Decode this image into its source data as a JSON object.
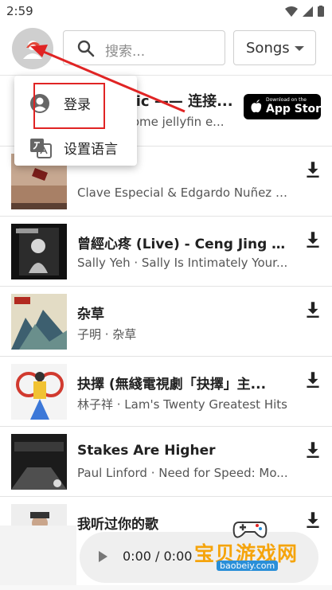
{
  "status_bar": {
    "time": "2:59"
  },
  "search": {
    "placeholder": "搜索..."
  },
  "filter": {
    "selected": "Songs"
  },
  "banner": {
    "title": "sic —— 连接...",
    "subtitle": "rome jellyfin e...",
    "badge_small": "Download on the",
    "badge_big": "App Store"
  },
  "songs": [
    {
      "title": "",
      "subtitle": "Clave Especial & Edgardo Nuñez · ..."
    },
    {
      "title": "曾經心疼 (Live) - Ceng Jing X...",
      "subtitle": "Sally Yeh · Sally Is Intimately Your..."
    },
    {
      "title": "杂草",
      "subtitle": "子明 · 杂草"
    },
    {
      "title": "抉擇 (無綫電視劇「抉擇」主...",
      "subtitle": "林子祥 · Lam's Twenty Greatest Hits"
    },
    {
      "title": "Stakes Are Higher",
      "subtitle": "Paul Linford · Need for Speed: Mo..."
    },
    {
      "title": "我听过你的歌",
      "subtitle": ""
    }
  ],
  "menu": {
    "items": [
      {
        "label": "登录",
        "icon": "account-circle-icon"
      },
      {
        "label": "设置语言",
        "icon": "translate-icon"
      }
    ]
  },
  "player": {
    "time": "0:00 / 0:00"
  },
  "watermark": {
    "main": "宝贝游戏网",
    "url": "baobeiy.com"
  },
  "colors": {
    "annotation": "#e02424",
    "watermark": "#f5a40c"
  }
}
